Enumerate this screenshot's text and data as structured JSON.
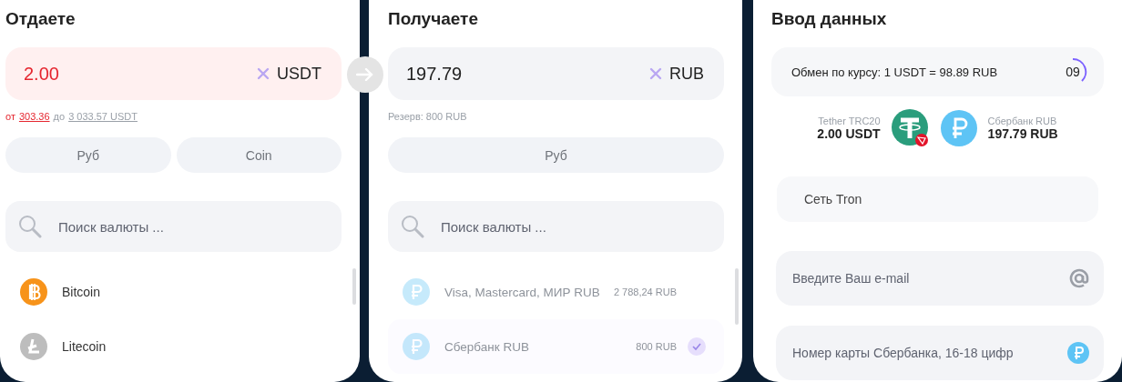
{
  "give": {
    "title": "Отдаете",
    "amount": "2.00",
    "currency": "USDT",
    "range": {
      "from_label": "от",
      "min": "303.36",
      "to_label": "до",
      "max": "3 033.57 USDT"
    },
    "filters": [
      {
        "label": "Руб",
        "selected": false
      },
      {
        "label": "Coin",
        "selected": false
      }
    ],
    "search": {
      "placeholder": "Поиск валюты ..."
    },
    "items": [
      {
        "name": "Bitcoin",
        "kind": "bitcoin",
        "disabled": false
      },
      {
        "name": "Litecoin",
        "kind": "litecoin",
        "disabled": false
      }
    ]
  },
  "get": {
    "title": "Получаете",
    "amount": "197.79",
    "currency": "RUB",
    "reserve": "Резерв: 800 RUB",
    "filters": [
      {
        "label": "Руб",
        "selected": false
      }
    ],
    "search": {
      "placeholder": "Поиск валюты ..."
    },
    "items": [
      {
        "name": "Visa, Mastercard, МИР RUB",
        "kind": "ruble",
        "amount": "2 788,24 RUB",
        "disabled": true,
        "selected": false
      },
      {
        "name": "Сбербанк RUB",
        "kind": "ruble",
        "amount": "800 RUB",
        "disabled": true,
        "selected": true
      }
    ]
  },
  "details": {
    "title": "Ввод данных",
    "rate": "Обмен по курсу: 1 USDT = 98.89 RUB",
    "timer": {
      "value": "09"
    },
    "from": {
      "name": "Tether TRC20",
      "amount": "2.00 USDT"
    },
    "to": {
      "name": "Сбербанк RUB",
      "amount": "197.79 RUB"
    },
    "network": {
      "value": "Сеть Tron"
    },
    "fields": [
      {
        "placeholder": "Введите Ваш e-mail",
        "kind": "email"
      },
      {
        "placeholder": "Номер карты Сбербанка, 16-18 цифр",
        "kind": "card"
      }
    ]
  }
}
